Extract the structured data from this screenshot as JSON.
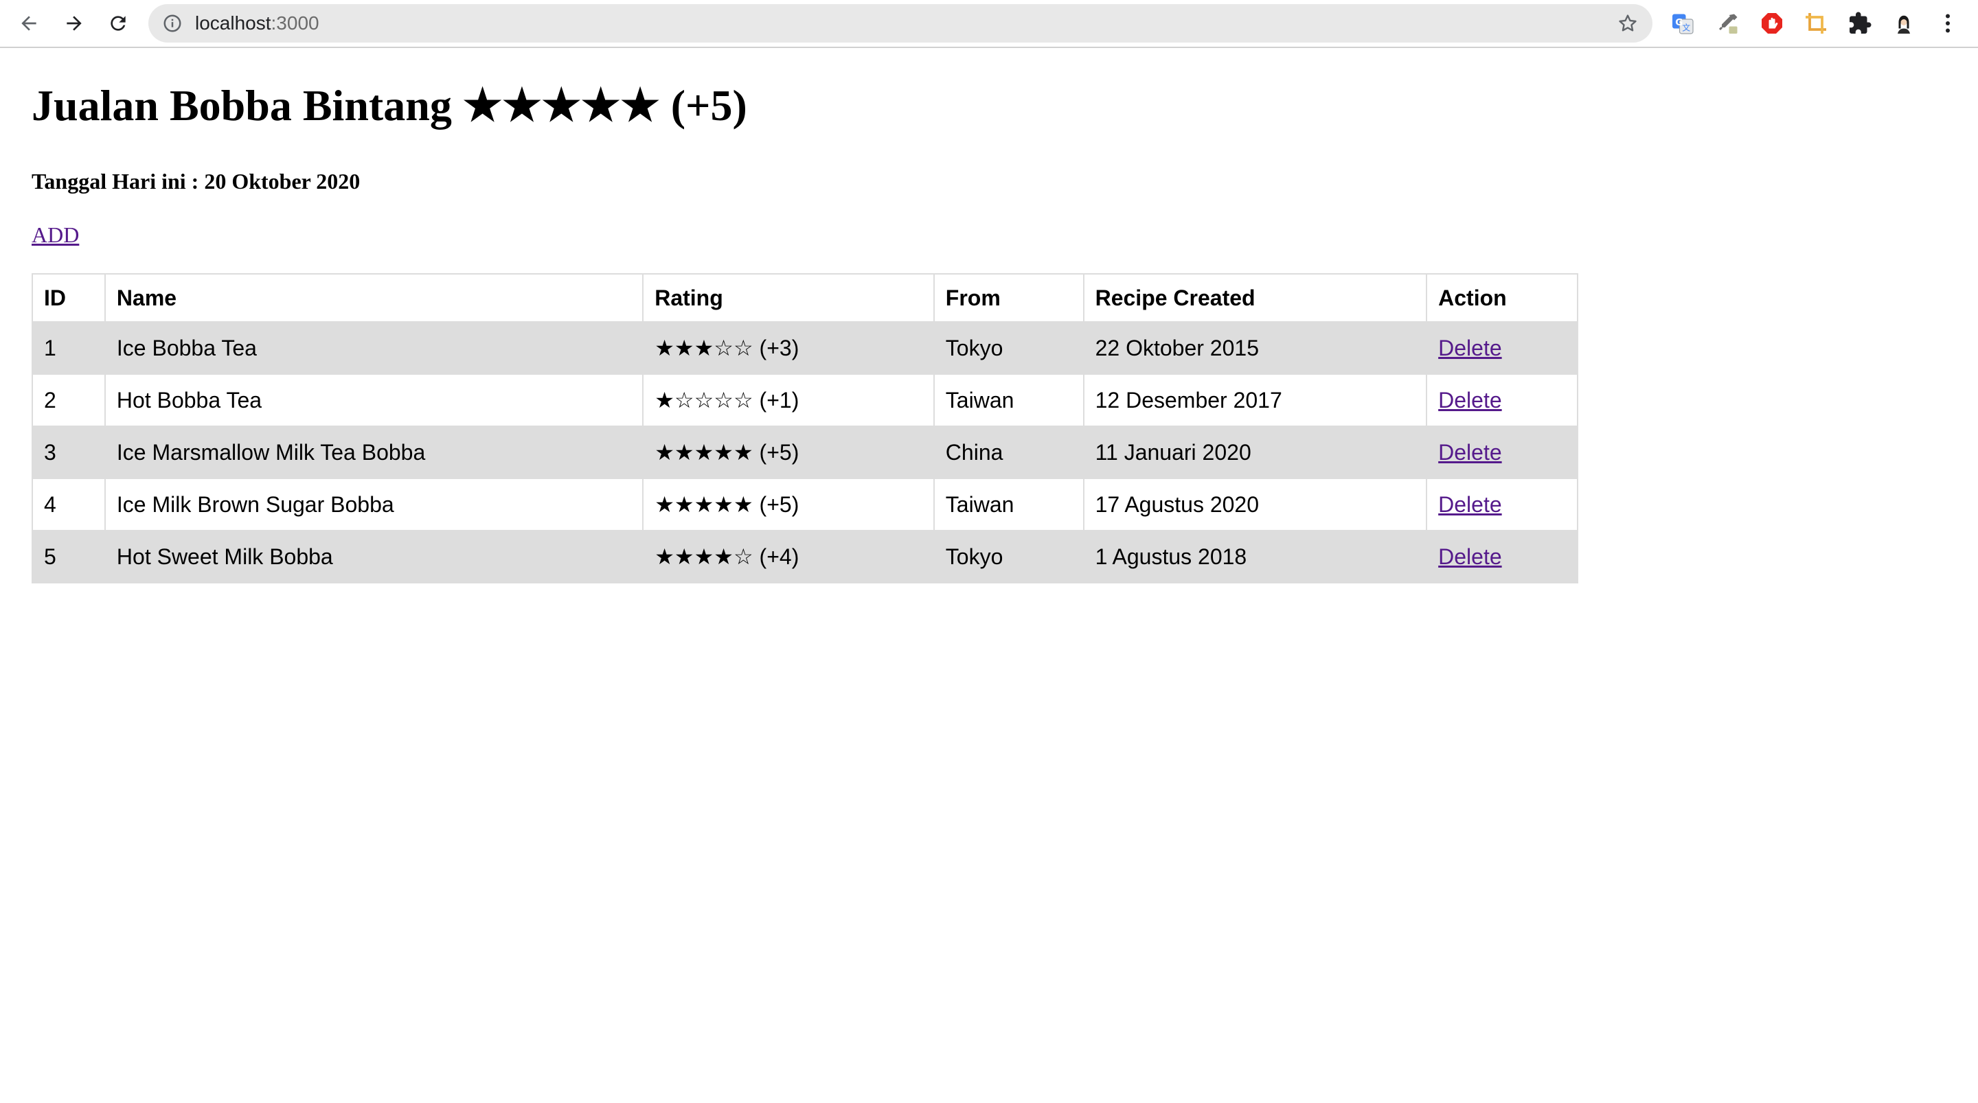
{
  "browser": {
    "url_host": "localhost",
    "url_port": ":3000"
  },
  "page": {
    "title": "Jualan Bobba Bintang ★★★★★ (+5)",
    "date_text": "Tanggal Hari ini : 20 Oktober 2020",
    "add_label": "ADD"
  },
  "table": {
    "headers": [
      "ID",
      "Name",
      "Rating",
      "From",
      "Recipe Created",
      "Action"
    ],
    "rows": [
      {
        "id": "1",
        "name": "Ice Bobba Tea",
        "rating": "★★★☆☆ (+3)",
        "from": "Tokyo",
        "created": "22 Oktober 2015",
        "action": "Delete"
      },
      {
        "id": "2",
        "name": "Hot Bobba Tea",
        "rating": "★☆☆☆☆ (+1)",
        "from": "Taiwan",
        "created": "12 Desember 2017",
        "action": "Delete"
      },
      {
        "id": "3",
        "name": "Ice Marsmallow Milk Tea Bobba",
        "rating": "★★★★★ (+5)",
        "from": "China",
        "created": "11 Januari 2020",
        "action": "Delete"
      },
      {
        "id": "4",
        "name": "Ice Milk Brown Sugar Bobba",
        "rating": "★★★★★ (+5)",
        "from": "Taiwan",
        "created": "17 Agustus 2020",
        "action": "Delete"
      },
      {
        "id": "5",
        "name": "Hot Sweet Milk Bobba",
        "rating": "★★★★☆ (+4)",
        "from": "Tokyo",
        "created": "1 Agustus 2018",
        "action": "Delete"
      }
    ]
  },
  "colors": {
    "link": "#551a8b",
    "row_stripe": "#dddddd",
    "omnibox": "#e8e8e8"
  },
  "icons": [
    "back-arrow-icon",
    "forward-arrow-icon",
    "reload-icon",
    "info-icon",
    "bookmark-star-icon",
    "translate-extension-icon",
    "eyedropper-extension-icon",
    "adblock-extension-icon",
    "crop-extension-icon",
    "puzzle-extensions-icon",
    "profile-avatar-icon",
    "kebab-menu-icon"
  ]
}
